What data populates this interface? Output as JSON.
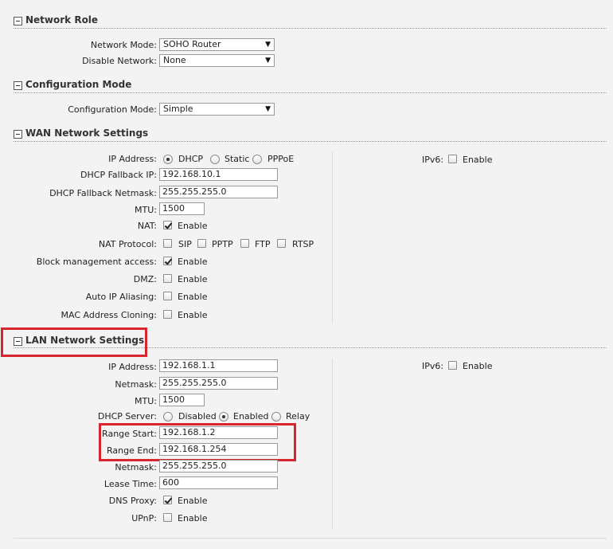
{
  "network_role": {
    "title": "Network Role",
    "network_mode_label": "Network Mode:",
    "network_mode_value": "SOHO Router",
    "disable_network_label": "Disable Network:",
    "disable_network_value": "None"
  },
  "configuration_mode": {
    "title": "Configuration Mode",
    "label": "Configuration Mode:",
    "value": "Simple"
  },
  "wan": {
    "title": "WAN Network Settings",
    "ip_address_label": "IP Address:",
    "ip_modes": [
      "DHCP",
      "Static",
      "PPPoE"
    ],
    "ip_mode_selected": "DHCP",
    "dhcp_fallback_ip_label": "DHCP Fallback IP:",
    "dhcp_fallback_ip_value": "192.168.10.1",
    "dhcp_fallback_netmask_label": "DHCP Fallback Netmask:",
    "dhcp_fallback_netmask_value": "255.255.255.0",
    "mtu_label": "MTU:",
    "mtu_value": "1500",
    "nat_label": "NAT:",
    "nat_enable": "Enable",
    "nat_protocol_label": "NAT Protocol:",
    "nat_protocols": [
      "SIP",
      "PPTP",
      "FTP",
      "RTSP"
    ],
    "block_mgmt_label": "Block management access:",
    "block_mgmt_enable": "Enable",
    "dmz_label": "DMZ:",
    "dmz_enable": "Enable",
    "auto_ip_label": "Auto IP Aliasing:",
    "auto_ip_enable": "Enable",
    "mac_clone_label": "MAC Address Cloning:",
    "mac_clone_enable": "Enable",
    "ipv6_label": "IPv6:",
    "ipv6_enable": "Enable"
  },
  "lan": {
    "title": "LAN Network Settings",
    "ip_address_label": "IP Address:",
    "ip_address_value": "192.168.1.1",
    "netmask_label": "Netmask:",
    "netmask_value": "255.255.255.0",
    "mtu_label": "MTU:",
    "mtu_value": "1500",
    "dhcp_server_label": "DHCP Server:",
    "dhcp_server_options": [
      "Disabled",
      "Enabled",
      "Relay"
    ],
    "dhcp_server_selected": "Enabled",
    "range_start_label": "Range Start:",
    "range_start_value": "192.168.1.2",
    "range_end_label": "Range End:",
    "range_end_value": "192.168.1.254",
    "dhcp_netmask_label": "Netmask:",
    "dhcp_netmask_value": "255.255.255.0",
    "lease_time_label": "Lease Time:",
    "lease_time_value": "600",
    "dns_proxy_label": "DNS Proxy:",
    "dns_proxy_enable": "Enable",
    "upnp_label": "UPnP:",
    "upnp_enable": "Enable",
    "ipv6_label": "IPv6:",
    "ipv6_enable": "Enable"
  },
  "colors": {
    "background": "#f3f3f3",
    "highlight": "#d7262e"
  }
}
